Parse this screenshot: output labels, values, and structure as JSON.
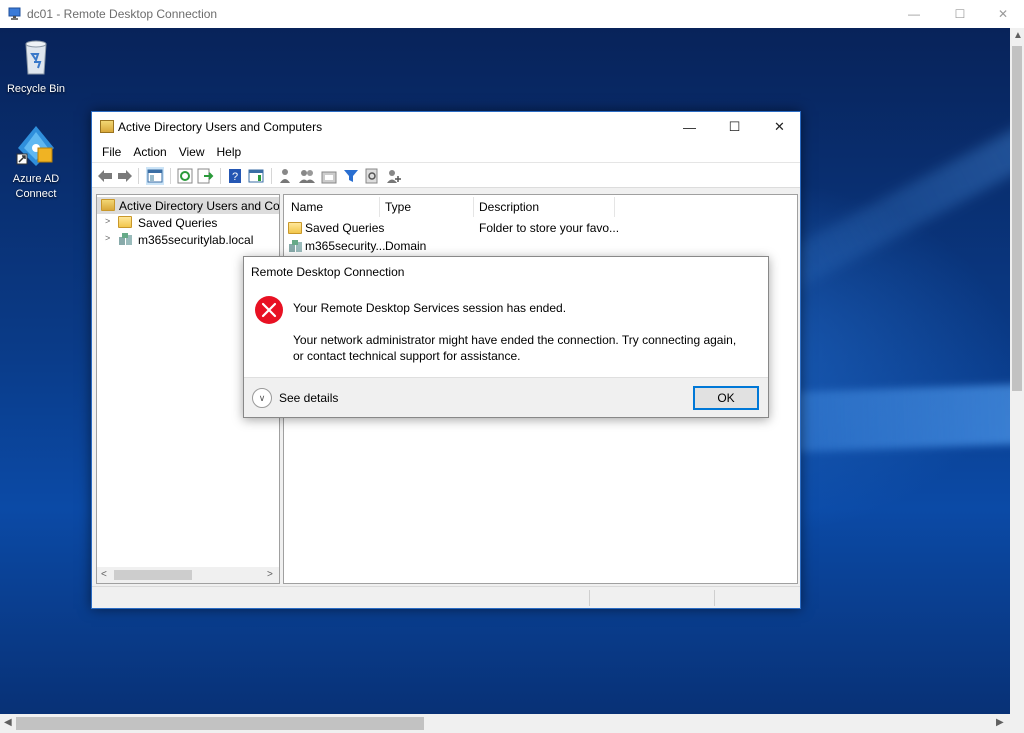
{
  "rdp_window": {
    "title": "dc01 - Remote Desktop Connection",
    "controls": {
      "minimize": "—",
      "maximize": "☐",
      "close": "✕"
    }
  },
  "desktop": {
    "icons": [
      {
        "label": "Recycle Bin",
        "icon": "recycle-bin-icon"
      },
      {
        "label": "Azure AD Connect",
        "icon": "azure-ad-connect-icon"
      }
    ]
  },
  "aduc_window": {
    "title": "Active Directory Users and Computers",
    "controls": {
      "minimize": "—",
      "maximize": "☐",
      "close": "✕"
    },
    "menu": [
      "File",
      "Action",
      "View",
      "Help"
    ],
    "tree": [
      {
        "label": "Active Directory Users and Comp",
        "selected": true
      },
      {
        "label": "Saved Queries",
        "icon": "folder-icon"
      },
      {
        "label": "m365securitylab.local",
        "icon": "domain-icon"
      }
    ],
    "list": {
      "columns": [
        "Name",
        "Type",
        "Description"
      ],
      "rows": [
        {
          "name": "Saved Queries",
          "type": "",
          "description": "Folder to store your favo...",
          "icon": "folder-icon"
        },
        {
          "name": "m365security...",
          "type": "Domain",
          "description": "",
          "icon": "domain-icon"
        }
      ]
    }
  },
  "dialog": {
    "title": "Remote Desktop Connection",
    "icon": "error-icon",
    "heading": "Your Remote Desktop Services session has ended.",
    "message": "Your network administrator might have ended the connection. Try connecting again, or contact technical support for assistance.",
    "details_label": "See details",
    "ok_label": "OK"
  }
}
